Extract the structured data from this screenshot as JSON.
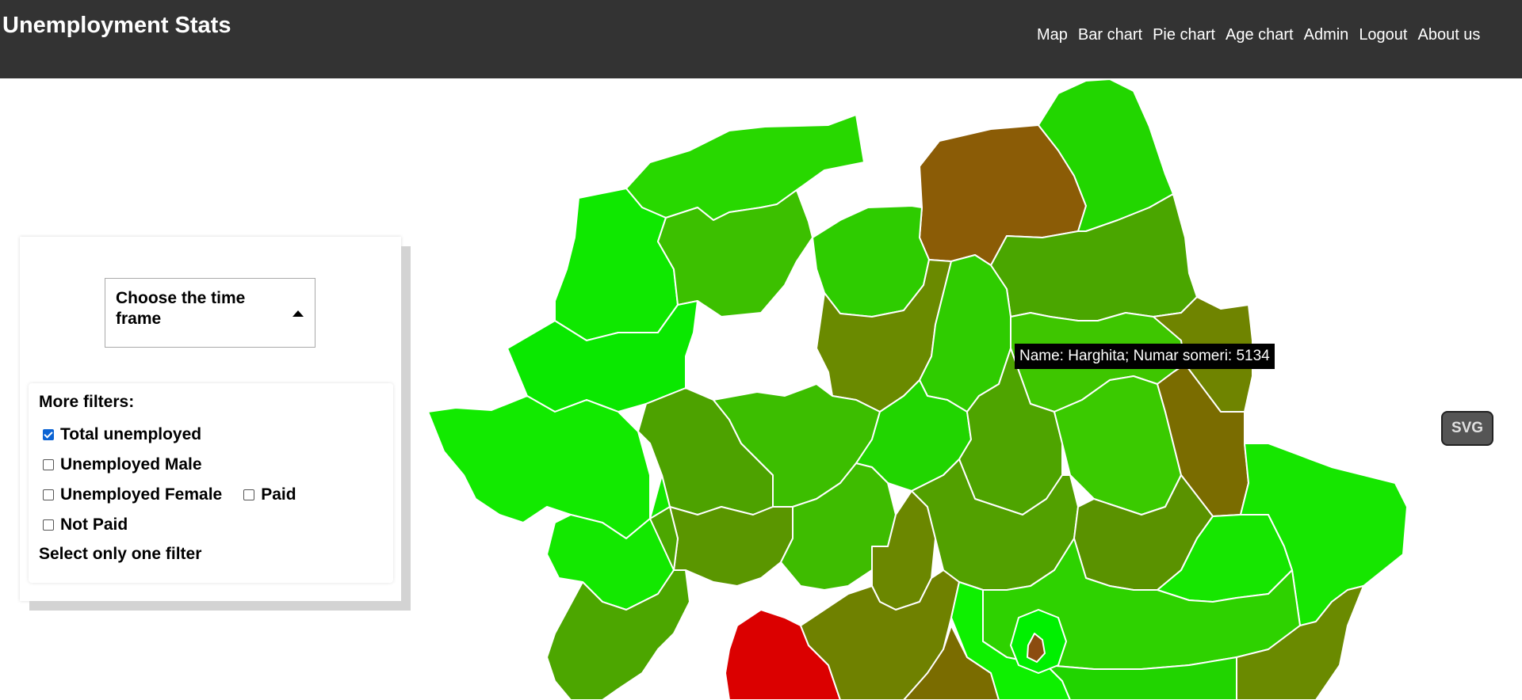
{
  "app": {
    "title": "Unemployment Stats"
  },
  "nav": [
    "Map",
    "Bar chart",
    "Pie chart",
    "Age chart",
    "Admin",
    "Logout",
    "About us"
  ],
  "timeframe": {
    "label": "Choose the time frame"
  },
  "filters": {
    "title": "More filters:",
    "options": [
      {
        "label": "Total unemployed",
        "checked": true
      },
      {
        "label": "Unemployed Male",
        "checked": false
      },
      {
        "label": "Unemployed Female",
        "checked": false
      },
      {
        "label": "Paid",
        "checked": false
      },
      {
        "label": "Not Paid",
        "checked": false
      }
    ],
    "hint": "Select only one filter"
  },
  "tooltip": "Name: Harghita; Numar someri: 5134",
  "svg_button": "SVG",
  "colors": {
    "header": "#333333",
    "high": "#d40000",
    "low": "#11ee00",
    "mid": "#6a8a00"
  }
}
